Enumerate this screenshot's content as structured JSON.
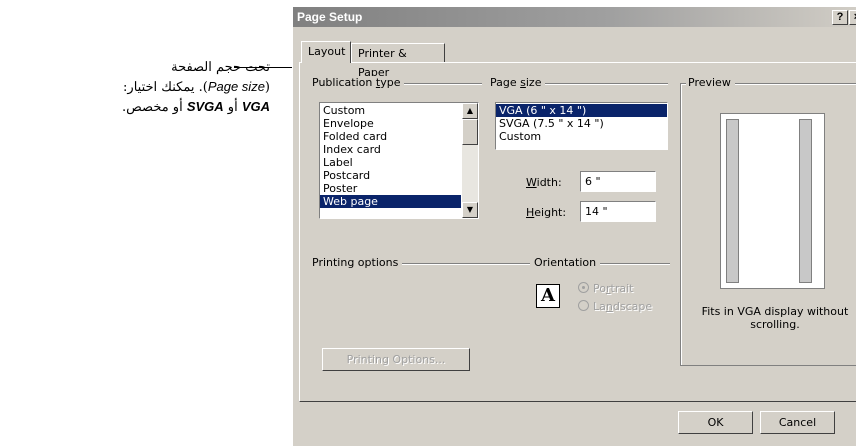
{
  "callout": {
    "line1": "تحت حجم الصفحة",
    "line2_term": "Page size",
    "line2_rest": "). يمكنك اختيار:",
    "line3_vga": "VGA",
    "line3_or": " أو ",
    "line3_svga": "SVGA",
    "line3_rest": " أو مخصص."
  },
  "dialog": {
    "title": "Page Setup",
    "help_button": "?",
    "close_button": "×",
    "tabs": [
      {
        "label": "Layout",
        "active": true
      },
      {
        "label": "Printer & Paper",
        "active": false
      }
    ],
    "publication_type": {
      "label_pre": "Publication ",
      "label_accel": "t",
      "label_post": "ype",
      "items": [
        "Custom",
        "Envelope",
        "Folded card",
        "Index card",
        "Label",
        "Postcard",
        "Poster",
        "Web page"
      ],
      "selected": "Web page"
    },
    "page_size": {
      "label_pre": "Page ",
      "label_accel": "s",
      "label_post": "ize",
      "items": [
        "VGA (6 \" x 14 \")",
        "SVGA (7.5 \" x 14 \")",
        "Custom"
      ],
      "selected": "VGA (6 \" x 14 \")"
    },
    "width": {
      "label_accel": "W",
      "label_rest": "idth:",
      "value": "6 \""
    },
    "height": {
      "label_accel": "H",
      "label_rest": "eight:",
      "value": "14 \""
    },
    "printing_options_label": "Printing options",
    "printing_options_button": "Printing Options...",
    "orientation": {
      "label": "Orientation",
      "portrait_pre": "Po",
      "portrait_accel": "r",
      "portrait_post": "trait",
      "landscape_pre": "La",
      "landscape_accel": "n",
      "landscape_post": "dscape",
      "selected": "portrait",
      "icon_letter": "A"
    },
    "preview": {
      "label": "Preview",
      "caption": "Fits in VGA display without scrolling."
    },
    "ok_button": "OK",
    "cancel_button": "Cancel"
  }
}
